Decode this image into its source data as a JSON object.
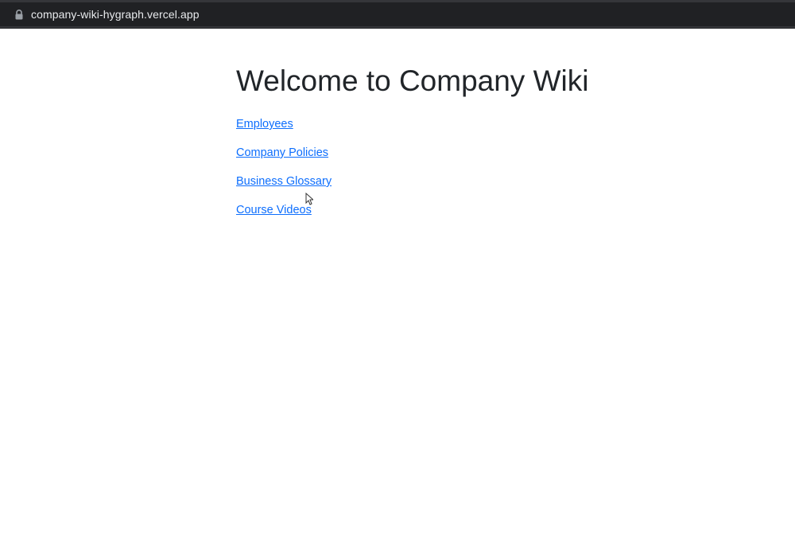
{
  "browser": {
    "url": "company-wiki-hygraph.vercel.app",
    "lock_icon": "lock-icon"
  },
  "main": {
    "title": "Welcome to Company Wiki",
    "links": [
      {
        "label": "Employees"
      },
      {
        "label": "Company Policies"
      },
      {
        "label": "Business Glossary"
      },
      {
        "label": "Course Videos"
      }
    ]
  },
  "colors": {
    "link": "#0d6efd",
    "title": "#212529",
    "browser_bar": "#202124"
  },
  "cursor_icon": "pointer-cursor-icon"
}
